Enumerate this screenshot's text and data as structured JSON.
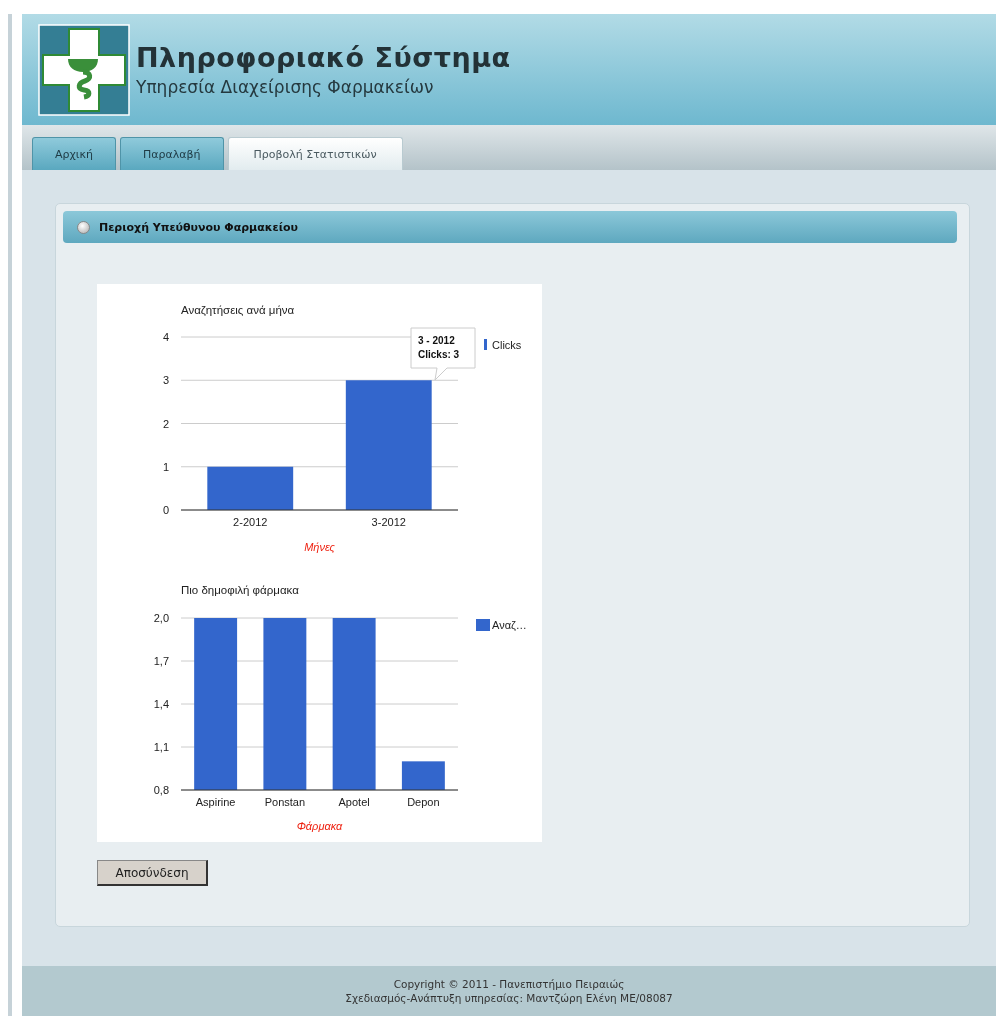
{
  "header": {
    "title": "Πληροφοριακό Σύστημα",
    "subtitle": "Υπηρεσία Διαχείρισης Φαρμακείων"
  },
  "tabs": [
    {
      "label": "Αρχική",
      "selected": false
    },
    {
      "label": "Παραλαβή",
      "selected": false
    },
    {
      "label": "Προβολή Στατιστικών",
      "selected": true
    }
  ],
  "panel": {
    "title": "Περιοχή Υπεύθυνου Φαρμακείου",
    "charts": [
      {
        "chart_data": {
          "type": "bar",
          "title": "Αναζητήσεις ανά μήνα",
          "xlabel": "Μήνες",
          "categories": [
            "2-2012",
            "3-2012"
          ],
          "series": [
            {
              "name": "Clicks",
              "color": "#3366cc",
              "values": [
                1,
                3
              ]
            }
          ],
          "ylim": [
            0,
            4
          ],
          "yticks": [
            0,
            1,
            2,
            3,
            4
          ],
          "grid": true
        },
        "tooltip": {
          "category": "3 - 2012",
          "value": "Clicks: 3"
        }
      },
      {
        "chart_data": {
          "type": "bar",
          "title": "Πιο δημοφιλή φάρμακα",
          "xlabel": "Φάρμακα",
          "categories": [
            "Aspirine",
            "Ponstan",
            "Apotel",
            "Depon"
          ],
          "series": [
            {
              "name": "Αναζ…",
              "color": "#3366cc",
              "values": [
                2,
                2,
                2,
                1
              ]
            }
          ],
          "ylim": [
            0.8,
            2.0
          ],
          "yticks": [
            {
              "value": 0.8,
              "label": "0,8"
            },
            {
              "value": 1.1,
              "label": "1,1"
            },
            {
              "value": 1.4,
              "label": "1,4"
            },
            {
              "value": 1.7,
              "label": "1,7"
            },
            {
              "value": 2.0,
              "label": "2,0"
            }
          ],
          "grid": true
        }
      }
    ],
    "button": "Αποσύνδεση"
  },
  "footer": [
    "Copyright © 2011 - Πανεπιστήμιο Πειραιώς",
    "Σχεδιασμός-Ανάπτυξη υπηρεσίας: Μαντζώρη Ελένη ΜΕ/08087"
  ]
}
